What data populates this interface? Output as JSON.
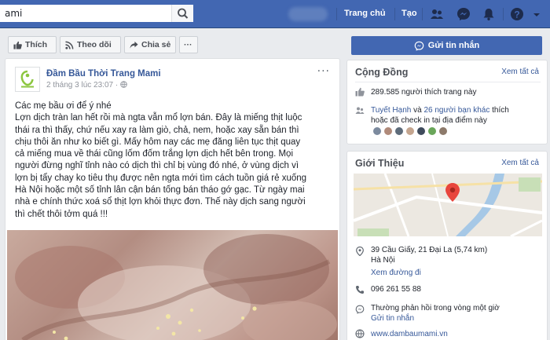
{
  "topbar": {
    "search_value": "ami",
    "nav_home": "Trang chủ",
    "nav_create": "Tạo"
  },
  "page_actions": {
    "like": "Thích",
    "follow": "Theo dõi",
    "share": "Chia sẻ",
    "more": "···"
  },
  "post": {
    "page_name": "Đầm Bầu Thời Trang Mami",
    "date": "2 tháng 3 lúc 23:07 · ",
    "menu": "···",
    "lines": [
      "Các mẹ bầu ơi để ý nhé",
      "Lợn dịch tràn lan hết rồi mà ngta vẫn mổ lợn bán. Đây là miếng thịt luộc",
      "thái ra thì thấy, chứ nếu xay ra làm giò, chả, nem, hoặc xay sẵn bán thì",
      "chịu thôi ăn như ko biết gì. Mấy hôm nay các mẹ đăng liên tục thịt quay",
      "cả miếng mua về thái cũng lốm đốm trắng lợn dịch hết bên trong. Mọi",
      "người đừng nghĩ tỉnh nào có dịch thì chỉ bị vùng đó nhé, ở vùng dịch vì",
      "lợn bị tẩy chay ko tiêu thụ được nên ngta mới tìm cách tuồn giá rẻ xuống",
      "Hà Nội hoặc một số tỉnh lân cận bán tống bán tháo gớ gạc. Từ ngày mai",
      "nhà e chính thức xoá sổ thịt lợn khỏi thực đơn. Thế này dịch sang người",
      "thì chết thôi tởm quá !!!"
    ]
  },
  "sidebar": {
    "message_button": "Gửi tin nhắn",
    "community": {
      "title": "Cộng Đồng",
      "see_all": "Xem tất cả",
      "likes": "289.585 người thích trang này",
      "checkin_name": "Tuyết Hạnh",
      "checkin_mid": " và ",
      "checkin_others": "26 người bạn khác",
      "checkin_tail1": " thích",
      "checkin_tail2": "hoặc đã check in tại địa điểm này"
    },
    "about": {
      "title": "Giới Thiệu",
      "see_all": "Xem tất cả",
      "address_line1": "39 Cầu Giấy, 21 Đại La (5,74 km)",
      "address_line2": "Hà Nội",
      "directions": "Xem đường đi",
      "phone": "096 261 55 88",
      "response": "Thường phản hồi trong vòng một giờ",
      "send_message": "Gửi tin nhắn",
      "website": "www.dambaumami.vn"
    }
  },
  "colors": {
    "brand_blue": "#4267b2",
    "link_blue": "#365899",
    "map_pin": "#e8453c"
  }
}
